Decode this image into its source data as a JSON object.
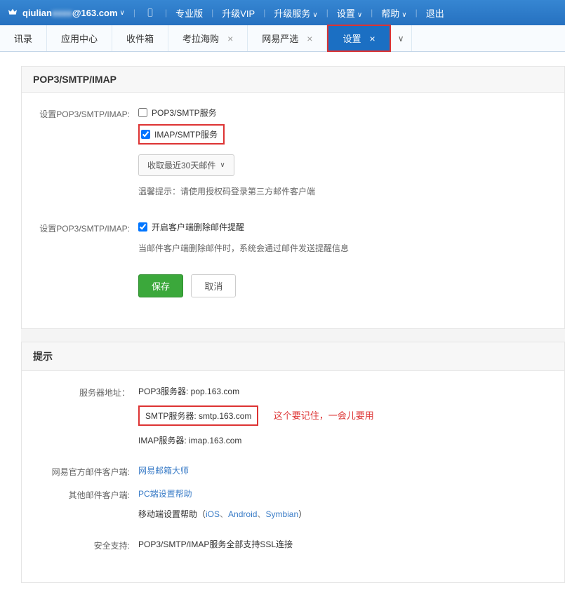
{
  "header": {
    "email_prefix": "qiulian",
    "email_blurred": "xxxx",
    "email_domain": "@163.com",
    "links": [
      "专业版",
      "升级VIP",
      "升级服务",
      "设置",
      "帮助",
      "退出"
    ]
  },
  "tabs": [
    {
      "label": "讯录",
      "closable": false
    },
    {
      "label": "应用中心",
      "closable": false
    },
    {
      "label": "收件箱",
      "closable": false
    },
    {
      "label": "考拉海购",
      "closable": true
    },
    {
      "label": "网易严选",
      "closable": true
    },
    {
      "label": "设置",
      "closable": true,
      "active": true
    }
  ],
  "section1": {
    "title": "POP3/SMTP/IMAP",
    "label1": "设置POP3/SMTP/IMAP:",
    "checkbox1": "POP3/SMTP服务",
    "checkbox2": "IMAP/SMTP服务",
    "dropdown": "收取最近30天邮件",
    "hint": "温馨提示：请使用授权码登录第三方邮件客户端",
    "label2": "设置POP3/SMTP/IMAP:",
    "checkbox3": "开启客户端删除邮件提醒",
    "hint2": "当邮件客户端删除邮件时，系统会通过邮件发送提醒信息",
    "save": "保存",
    "cancel": "取消"
  },
  "section2": {
    "title": "提示",
    "rows": {
      "server_label": "服务器地址：",
      "pop3": "POP3服务器: pop.163.com",
      "smtp": "SMTP服务器: smtp.163.com",
      "smtp_note": "这个要记住，一会儿要用",
      "imap": "IMAP服务器: imap.163.com",
      "official_label": "网易官方邮件客户端:",
      "official_link": "网易邮箱大师",
      "other_label": "其他邮件客户端:",
      "pc_link": "PC端设置帮助",
      "mobile_prefix": "移动端设置帮助（",
      "mobile_ios": "iOS",
      "mobile_sep": "、",
      "mobile_android": "Android",
      "mobile_symbian": "Symbian",
      "mobile_suffix": "）",
      "ssl_label": "安全支持:",
      "ssl_text": "POP3/SMTP/IMAP服务全部支持SSL连接"
    }
  }
}
